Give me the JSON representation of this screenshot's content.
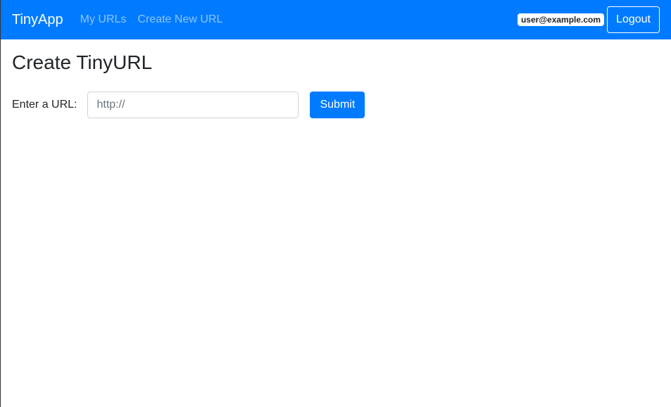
{
  "navbar": {
    "brand": "TinyApp",
    "links": [
      {
        "label": "My URLs"
      },
      {
        "label": "Create New URL"
      }
    ],
    "user_email": "user@example.com",
    "logout_label": "Logout",
    "background_color": "#007bff"
  },
  "main": {
    "title": "Create TinyURL",
    "form": {
      "label": "Enter a URL:",
      "input_value": "",
      "input_placeholder": "http://",
      "submit_label": "Submit"
    }
  },
  "colors": {
    "accent": "#007bff",
    "text": "#212529",
    "nav_link": "rgba(255,255,255,0.55)"
  }
}
